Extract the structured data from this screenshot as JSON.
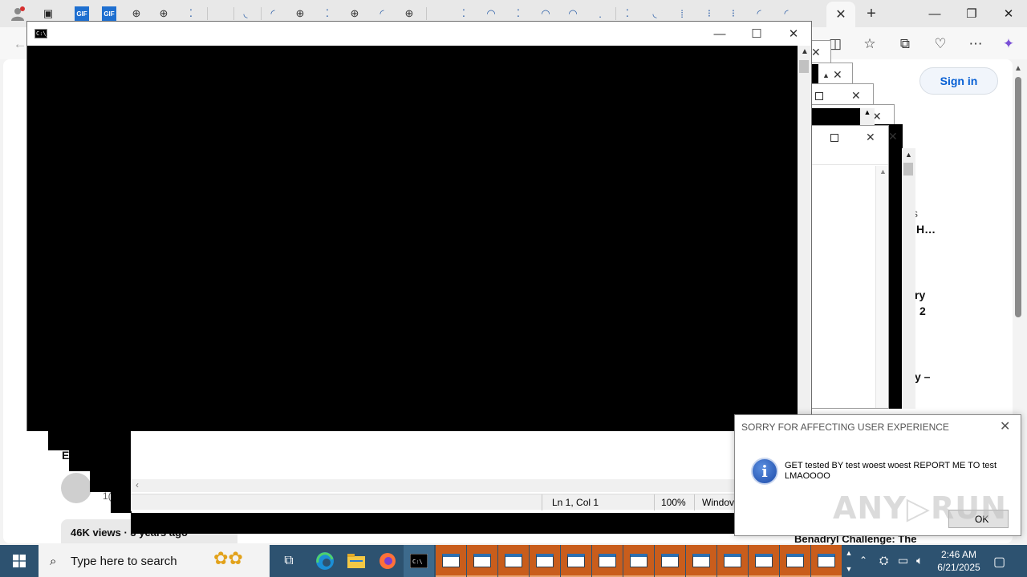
{
  "browser": {
    "active_tab_close": "✕",
    "new_tab": "+",
    "window_controls": {
      "minimize": "—",
      "restore": "❐",
      "close": "✕"
    }
  },
  "page": {
    "sign_in": "Sign in",
    "fragments": {
      "t1": "s",
      "t2": "H…",
      "t3": "ry",
      "t4": "2",
      "t5": "y –",
      "t6": "E",
      "t7": "1(",
      "views": "46K views · 3 years ago",
      "benadryl": "Benadryl Challenge: The"
    }
  },
  "cmd_window": {
    "icon_text": "C:\\_",
    "controls": {
      "minimize": "—",
      "maximize": "☐",
      "close": "✕"
    }
  },
  "notepad": {
    "status": {
      "position": "Ln 1, Col 1",
      "zoom": "100%",
      "line_ending": "Windov"
    }
  },
  "message_box": {
    "title": "SORRY FOR AFFECTING USER EXPERIENCE",
    "message": "GET tested BY test woest woest REPORT ME TO test LMAOOOO",
    "ok_label": "OK",
    "icon": "info-icon"
  },
  "watermark": "ANY▷RUN",
  "taskbar": {
    "search_placeholder": "Type here to search",
    "clock_time": "2:46 AM",
    "clock_date": "6/21/2025"
  }
}
